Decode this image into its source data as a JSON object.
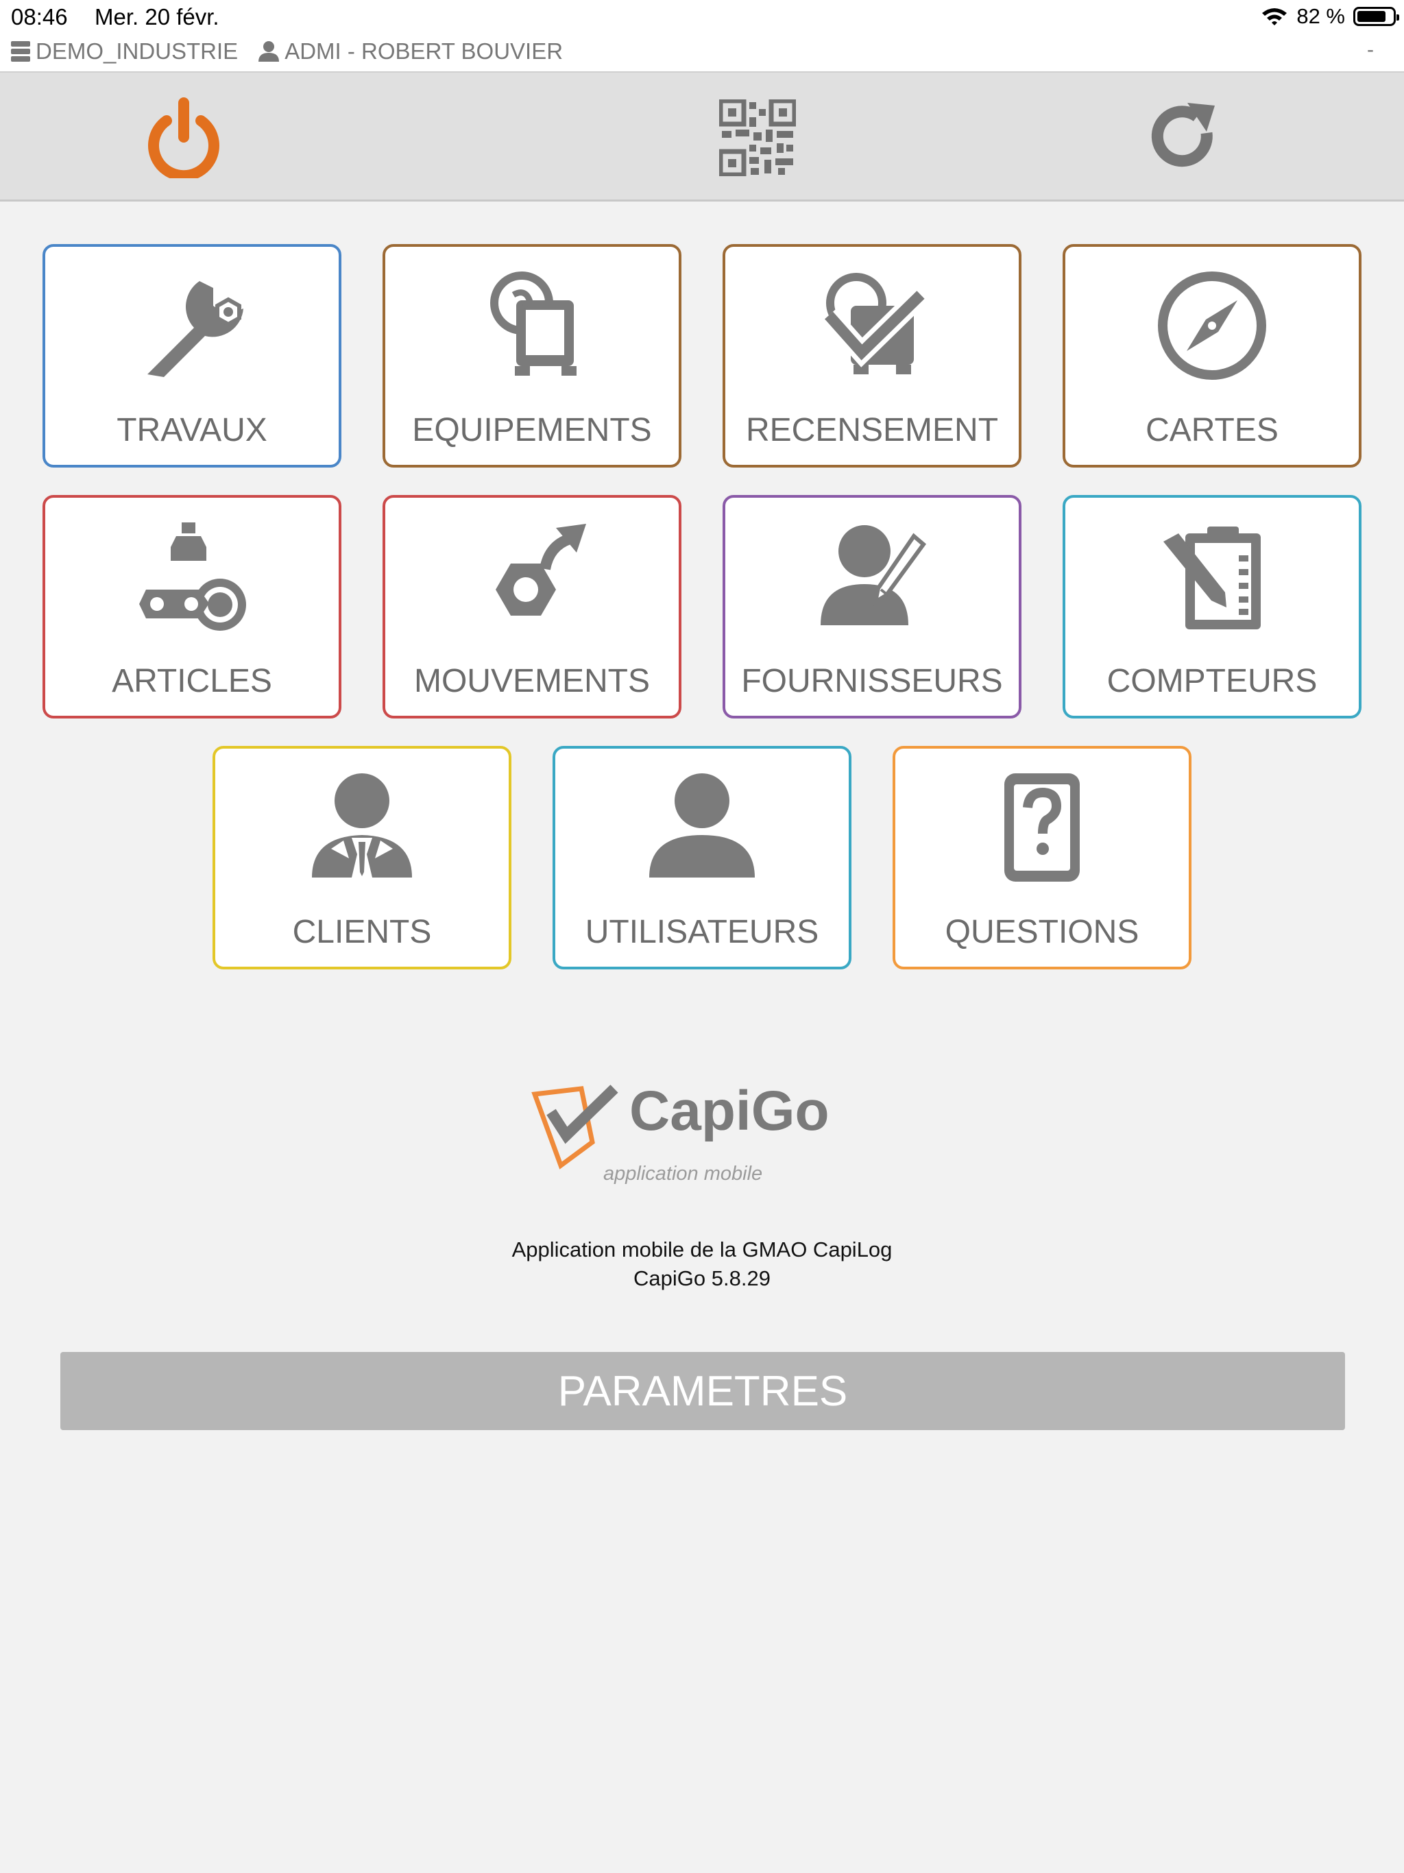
{
  "status_bar": {
    "time": "08:46",
    "date": "Mer. 20 févr.",
    "battery": "82 %",
    "battery_level": 0.82,
    "database": "DEMO_INDUSTRIE",
    "user": "ADMI - ROBERT BOUVIER",
    "dash": "-"
  },
  "toolbar": {
    "power_icon": "power-icon",
    "qr_icon": "qr-code-icon",
    "refresh_icon": "refresh-icon",
    "power_color": "#e2701e"
  },
  "menu": {
    "tiles": [
      {
        "label": "TRAVAUX",
        "icon": "wrench-icon",
        "color": "#4a86c8"
      },
      {
        "label": "EQUIPEMENTS",
        "icon": "equipment-icon",
        "color": "#9c6a35"
      },
      {
        "label": "RECENSEMENT",
        "icon": "census-check-icon",
        "color": "#9c6a35"
      },
      {
        "label": "CARTES",
        "icon": "compass-icon",
        "color": "#9c6a35"
      },
      {
        "label": "ARTICLES",
        "icon": "parts-icon",
        "color": "#cc4a4a"
      },
      {
        "label": "MOUVEMENTS",
        "icon": "movement-icon",
        "color": "#cc4a4a"
      },
      {
        "label": "FOURNISSEURS",
        "icon": "supplier-icon",
        "color": "#8a5aa8"
      },
      {
        "label": "COMPTEURS",
        "icon": "meter-icon",
        "color": "#3aa8c4"
      },
      {
        "label": "CLIENTS",
        "icon": "client-icon",
        "color": "#e3c728"
      },
      {
        "label": "UTILISATEURS",
        "icon": "user-icon",
        "color": "#3aa8c4"
      },
      {
        "label": "QUESTIONS",
        "icon": "question-icon",
        "color": "#f29a3c"
      }
    ]
  },
  "brand": {
    "name": "CapiGo",
    "tagline": "application mobile",
    "logo_color": "#ef8a3a"
  },
  "about": {
    "line1": "Application mobile de la GMAO CapiLog",
    "line2": "CapiGo 5.8.29"
  },
  "settings_button": "PARAMETRES"
}
